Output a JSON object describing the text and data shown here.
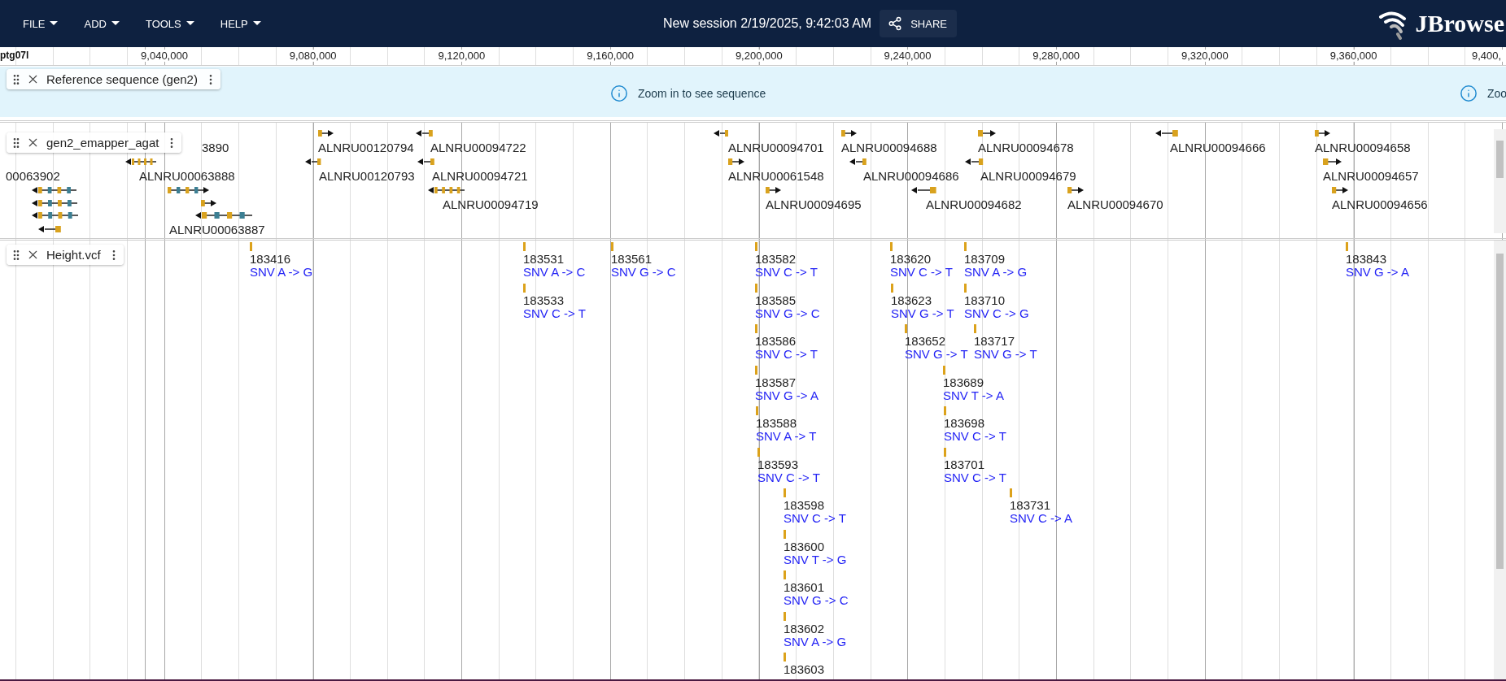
{
  "menu": [
    {
      "label": "FILE"
    },
    {
      "label": "ADD"
    },
    {
      "label": "TOOLS"
    },
    {
      "label": "HELP"
    }
  ],
  "session_title": "New session 2/19/2025, 9:42:03 AM",
  "share_button": "SHARE",
  "logo_text": "JBrowse",
  "ruler": {
    "refname": "ptg07l",
    "ticks": [
      "9,040,000",
      "9,080,000",
      "9,120,000",
      "9,160,000",
      "9,200,000",
      "9,240,000",
      "9,280,000",
      "9,320,000",
      "9,360,000",
      "9,400,"
    ]
  },
  "tracks": [
    {
      "kind": "reference",
      "name": "Reference sequence (gen2)",
      "messages": [
        "Zoom in to see sequence",
        "Zoo"
      ]
    },
    {
      "kind": "genes",
      "name": "gen2_emapper_agat",
      "features": [
        {
          "label": "3890"
        },
        {
          "label": "ALNRU00120794",
          "reverse_strand": false
        },
        {
          "label": "ALNRU00094722",
          "reverse_strand": true
        },
        {
          "label": "ALNRU00094701",
          "reverse_strand": true
        },
        {
          "label": "ALNRU00094688",
          "reverse_strand": false
        },
        {
          "label": "ALNRU00094678",
          "reverse_strand": false
        },
        {
          "label": "ALNRU00094666",
          "reverse_strand": true
        },
        {
          "label": "ALNRU00094658",
          "reverse_strand": false
        },
        {
          "label": "00063902"
        },
        {
          "label": "ALNRU00063888",
          "reverse_strand": true
        },
        {
          "label": "ALNRU00120793",
          "reverse_strand": true
        },
        {
          "label": "ALNRU00094721",
          "reverse_strand": true
        },
        {
          "label": "ALNRU00061548",
          "reverse_strand": false
        },
        {
          "label": "ALNRU00094686",
          "reverse_strand": true
        },
        {
          "label": "ALNRU00094679",
          "reverse_strand": true
        },
        {
          "label": "ALNRU00094657",
          "reverse_strand": false
        },
        {
          "label": "ALNRU00094719",
          "reverse_strand": true
        },
        {
          "label": "ALNRU00094695",
          "reverse_strand": false
        },
        {
          "label": "ALNRU00094682",
          "reverse_strand": true
        },
        {
          "label": "ALNRU00094670",
          "reverse_strand": false
        },
        {
          "label": "ALNRU00094656",
          "reverse_strand": false
        },
        {
          "label": "ALNRU00063887",
          "reverse_strand": true
        },
        {
          "reverse_strand": true
        },
        {
          "reverse_strand": true
        },
        {
          "reverse_strand": true
        },
        {
          "reverse_strand": true
        },
        {
          "reverse_strand": false
        },
        {
          "reverse_strand": false
        }
      ]
    },
    {
      "kind": "variants",
      "name": "Height.vcf",
      "features": [
        {
          "id": "183416",
          "description": "SNV A -> G"
        },
        {
          "id": "183531",
          "description": "SNV A -> C"
        },
        {
          "id": "183561",
          "description": "SNV G -> C"
        },
        {
          "id": "183582",
          "description": "SNV C -> T"
        },
        {
          "id": "183620",
          "description": "SNV C -> T"
        },
        {
          "id": "183709",
          "description": "SNV A -> G"
        },
        {
          "id": "183843",
          "description": "SNV G -> A"
        },
        {
          "id": "183533",
          "description": "SNV C -> T"
        },
        {
          "id": "183585",
          "description": "SNV G -> C"
        },
        {
          "id": "183623",
          "description": "SNV G -> T"
        },
        {
          "id": "183710",
          "description": "SNV C -> G"
        },
        {
          "id": "183586",
          "description": "SNV C -> T"
        },
        {
          "id": "183652",
          "description": "SNV G -> T"
        },
        {
          "id": "183717",
          "description": "SNV G -> T"
        },
        {
          "id": "183587",
          "description": "SNV G -> A"
        },
        {
          "id": "183689",
          "description": "SNV T -> A"
        },
        {
          "id": "183588",
          "description": "SNV A -> T"
        },
        {
          "id": "183698",
          "description": "SNV C -> T"
        },
        {
          "id": "183593",
          "description": "SNV C -> T"
        },
        {
          "id": "183701",
          "description": "SNV C -> T"
        },
        {
          "id": "183598",
          "description": "SNV C -> T"
        },
        {
          "id": "183731",
          "description": "SNV C -> A"
        },
        {
          "id": "183600",
          "description": "SNV T -> G"
        },
        {
          "id": "183601",
          "description": "SNV G -> C"
        },
        {
          "id": "183602",
          "description": "SNV A -> G"
        },
        {
          "id": "183603"
        }
      ]
    }
  ]
}
